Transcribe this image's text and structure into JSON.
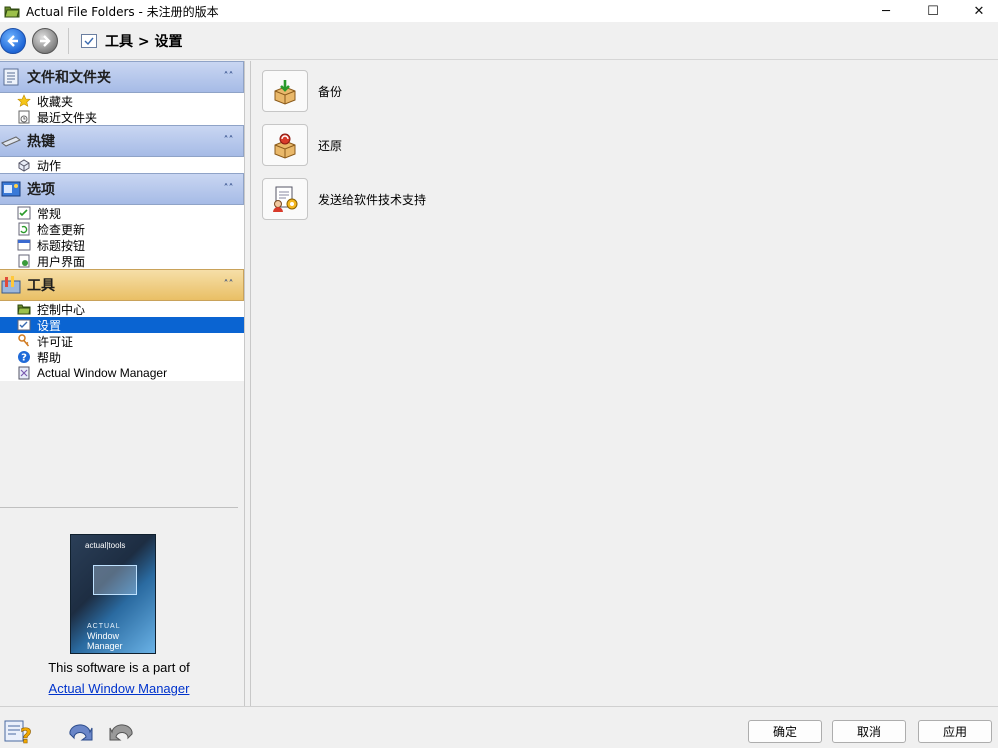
{
  "window": {
    "title": "Actual File Folders - 未注册的版本",
    "minimize_glyph": "─",
    "maximize_glyph": "☐",
    "close_glyph": "✕"
  },
  "toolbar": {
    "breadcrumb": "工具 > 设置"
  },
  "sidebar": {
    "groups": [
      {
        "title": "文件和文件夹",
        "icon": "document-list-icon",
        "items": [
          {
            "label": "收藏夹",
            "icon": "star-icon"
          },
          {
            "label": "最近文件夹",
            "icon": "clock-document-icon"
          }
        ]
      },
      {
        "title": "热键",
        "icon": "keyboard-icon",
        "items": [
          {
            "label": "动作",
            "icon": "cube-icon"
          }
        ]
      },
      {
        "title": "选项",
        "icon": "options-icon",
        "items": [
          {
            "label": "常规",
            "icon": "general-settings-icon"
          },
          {
            "label": "检查更新",
            "icon": "update-check-icon"
          },
          {
            "label": "标题按钮",
            "icon": "title-buttons-icon"
          },
          {
            "label": "用户界面",
            "icon": "user-interface-icon"
          }
        ]
      },
      {
        "title": "工具",
        "icon": "tools-icon",
        "items": [
          {
            "label": "控制中心",
            "icon": "folder-icon"
          },
          {
            "label": "设置",
            "icon": "settings-checkbox-icon",
            "selected": true
          },
          {
            "label": "许可证",
            "icon": "key-icon"
          },
          {
            "label": "帮助",
            "icon": "help-icon"
          },
          {
            "label": "Actual Window Manager",
            "icon": "window-manager-icon"
          }
        ]
      }
    ],
    "collapse_glyph": "˄˄",
    "promo": {
      "brand": "actual|tools",
      "product_line1": "ACTUAL",
      "product_line2": "Window Manager",
      "text": "This software is a part of",
      "link": "Actual Window Manager"
    }
  },
  "main": {
    "tools": [
      {
        "label": "备份",
        "icon": "backup-box-icon"
      },
      {
        "label": "还原",
        "icon": "restore-box-icon"
      },
      {
        "label": "发送给软件技术支持",
        "icon": "send-support-icon"
      }
    ]
  },
  "bottom": {
    "ok": "确定",
    "cancel": "取消",
    "apply": "应用"
  },
  "colors": {
    "selection": "#0a64d2",
    "group_header_blue": "#a6bbe6",
    "group_header_gold": "#e9bf65",
    "link": "#0033cc"
  }
}
